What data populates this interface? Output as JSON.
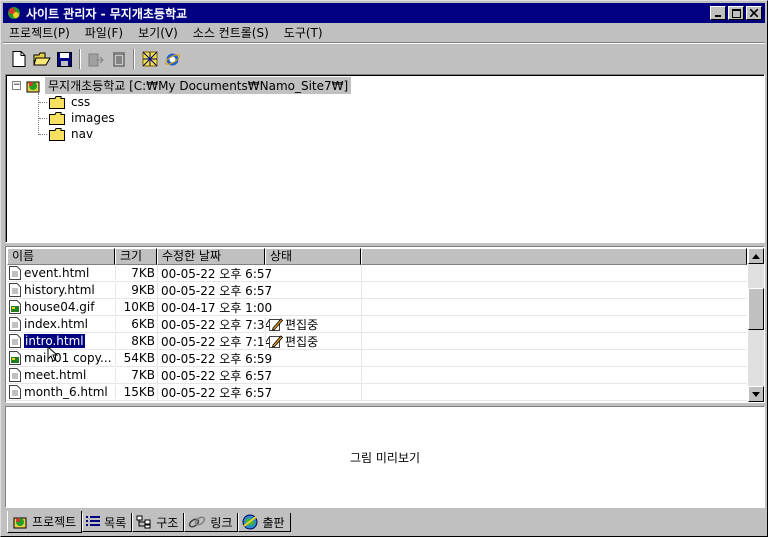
{
  "window": {
    "title": "사이트 관리자 - 무지개초등학교"
  },
  "menubar": [
    {
      "label": "프로젝트(P)"
    },
    {
      "label": "파일(F)"
    },
    {
      "label": "보기(V)"
    },
    {
      "label": "소스 컨트롤(S)"
    },
    {
      "label": "도구(T)"
    }
  ],
  "toolbar": {
    "buttons": [
      "new-file-icon",
      "open-folder-icon",
      "save-icon",
      "export-icon",
      "delete-icon",
      "site-map-icon",
      "ie-browser-icon"
    ]
  },
  "tree": {
    "root": "무지개초등학교 [C:₩My Documents₩Namo_Site7₩]",
    "expander": "−",
    "folders": [
      "css",
      "images",
      "nav"
    ]
  },
  "list": {
    "headers": {
      "name": "이름",
      "size": "크기",
      "date": "수정한 날짜",
      "status": "상태"
    },
    "rows": [
      {
        "name": "event.html",
        "size": "7KB",
        "date": "00-05-22 오후 6:57",
        "status": ""
      },
      {
        "name": "history.html",
        "size": "9KB",
        "date": "00-05-22 오후 6:57",
        "status": ""
      },
      {
        "name": "house04.gif",
        "size": "10KB",
        "date": "00-04-17 오후 1:00",
        "status": ""
      },
      {
        "name": "index.html",
        "size": "6KB",
        "date": "00-05-22 오후 7:34",
        "status": "편집중"
      },
      {
        "name": "intro.html",
        "size": "8KB",
        "date": "00-05-22 오후 7:14",
        "status": "편집중"
      },
      {
        "name": "main01 copy...",
        "size": "54KB",
        "date": "00-05-22 오후 6:59",
        "status": ""
      },
      {
        "name": "meet.html",
        "size": "7KB",
        "date": "00-05-22 오후 6:57",
        "status": ""
      },
      {
        "name": "month_6.html",
        "size": "15KB",
        "date": "00-05-22 오후 6:57",
        "status": ""
      }
    ]
  },
  "preview": {
    "label": "그림 미리보기"
  },
  "tabs": [
    {
      "label": "프로젝트"
    },
    {
      "label": "목록"
    },
    {
      "label": "구조"
    },
    {
      "label": "링크"
    },
    {
      "label": "출판"
    }
  ]
}
